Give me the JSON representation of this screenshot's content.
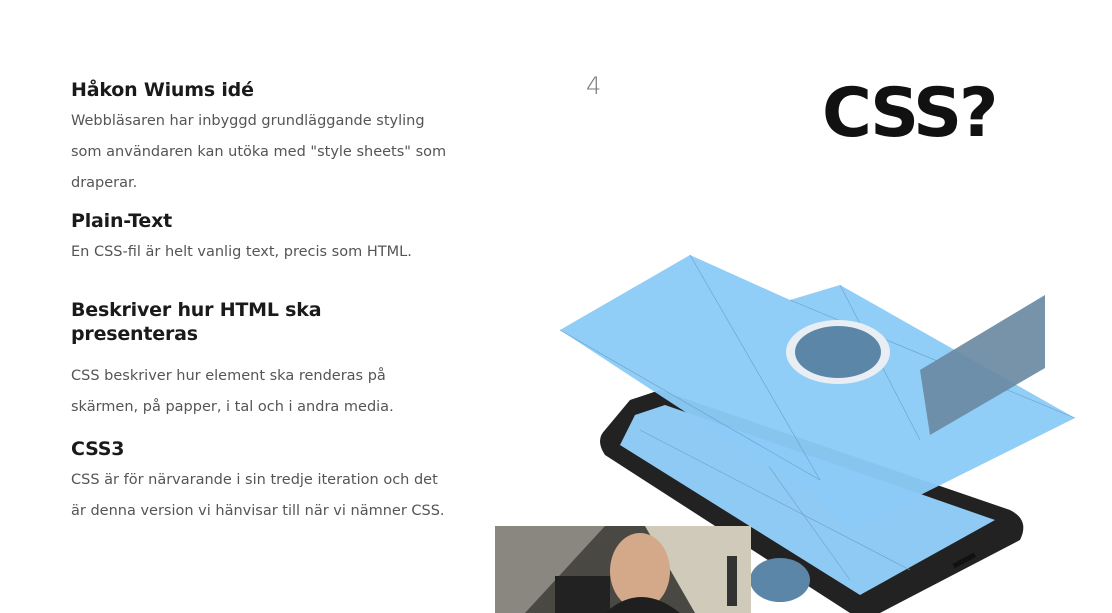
{
  "slide": {
    "page_number": "4",
    "title": "CSS?",
    "sections": [
      {
        "heading": "Håkon Wiums idé",
        "text": "Webbläsaren har inbyggd grundläggande styling som användaren kan utöka med \"style sheets\" som draperar."
      },
      {
        "heading": "Plain-Text",
        "text": "En CSS-fil är helt vanlig text, precis som HTML."
      },
      {
        "heading": "Beskriver hur HTML ska presenteras",
        "text": "CSS beskriver hur element ska renderas på skärmen, på papper, i tal och i andra media."
      },
      {
        "heading": "CSS3",
        "text": "CSS är för närvarande i sin tredje iteration och det är denna version vi hänvisar till när vi nämner CSS."
      }
    ]
  },
  "colors": {
    "accent_blue": "#85c6f5",
    "phone_dark": "#222222",
    "grey_blue": "#6a8aa3"
  },
  "icons": [
    "phone-illustration",
    "webcam-feed"
  ]
}
